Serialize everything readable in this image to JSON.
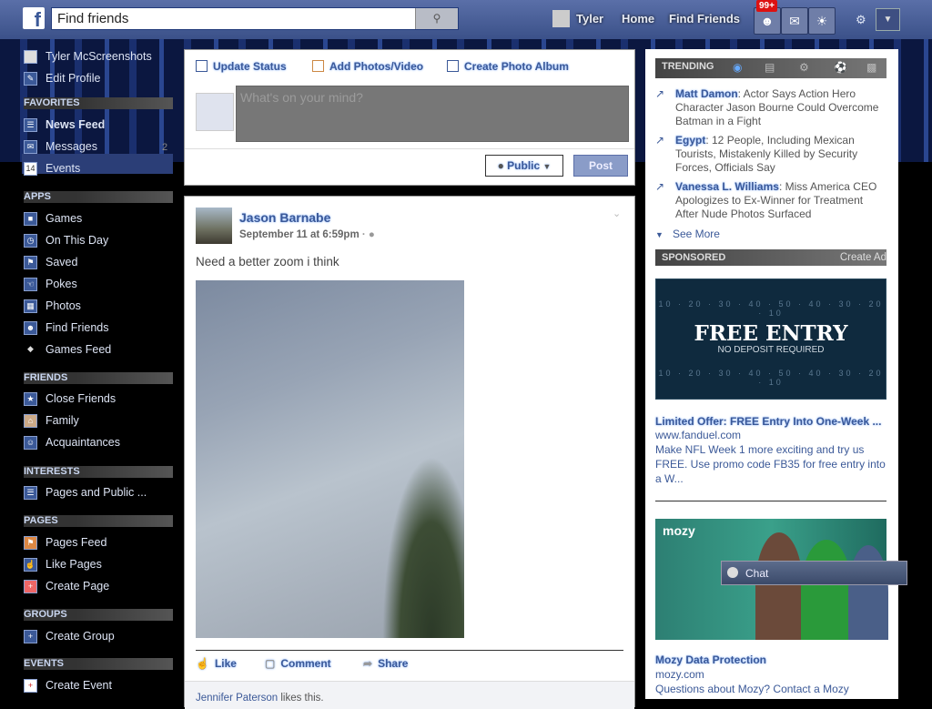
{
  "header": {
    "logo": "f",
    "search_placeholder": "Find friends",
    "user_name": "Tyler",
    "home": "Home",
    "find_friends": "Find Friends",
    "notif_count": "99+"
  },
  "sidebar": {
    "profile_name": "Tyler McScreenshots",
    "edit_profile": "Edit Profile",
    "sections": {
      "favorites": "FAVORITES",
      "apps": "APPS",
      "friends": "FRIENDS",
      "interests": "INTERESTS",
      "pages": "PAGES",
      "groups": "GROUPS",
      "events": "EVENTS"
    },
    "favorites": [
      "News Feed",
      "Messages",
      "Events"
    ],
    "messages_count": "2",
    "events_date": "14",
    "apps": [
      "Games",
      "On This Day",
      "Saved",
      "Pokes",
      "Photos",
      "Find Friends",
      "Games Feed"
    ],
    "friends": [
      "Close Friends",
      "Family",
      "Acquaintances"
    ],
    "interests": [
      "Pages and Public ..."
    ],
    "pages": [
      "Pages Feed",
      "Like Pages",
      "Create Page"
    ],
    "groups": [
      "Create Group"
    ],
    "events": [
      "Create Event"
    ]
  },
  "composer": {
    "tabs": [
      "Update Status",
      "Add Photos/Video",
      "Create Photo Album"
    ],
    "placeholder": "What's on your mind?",
    "privacy": "Public",
    "post": "Post"
  },
  "story": {
    "author": "Jason Barnabe",
    "time": "September 11 at 6:59pm",
    "text": "Need a better zoom i think",
    "actions": [
      "Like",
      "Comment",
      "Share"
    ],
    "liker": "Jennifer Paterson",
    "likes_suffix": " likes this."
  },
  "trending": {
    "title": "TRENDING",
    "items": [
      {
        "name": "Matt Damon",
        "text": ": Actor Says Action Hero Character Jason Bourne Could Overcome Batman in a Fight"
      },
      {
        "name": "Egypt",
        "text": ": 12 People, Including Mexican Tourists, Mistakenly Killed by Security Forces, Officials Say"
      },
      {
        "name": "Vanessa L. Williams",
        "text": ": Miss America CEO Apologizes to Ex-Winner for Treatment After Nude Photos Surfaced"
      }
    ],
    "see_more": "See More"
  },
  "sponsored": {
    "title": "SPONSORED",
    "create_ad": "Create Ad",
    "ad1": {
      "image_big": "FREE ENTRY",
      "image_small": "NO DEPOSIT REQUIRED",
      "yard_top": "10 · 20 · 30 · 40 · 50 · 40 · 30 · 20 · 10",
      "yard_bottom": "10 · 20 · 30 · 40 · 50 · 40 · 30 · 20 · 10",
      "title": "Limited Offer: FREE Entry Into One-Week ...",
      "url": "www.fanduel.com",
      "body": "Make NFL Week 1 more exciting and try us FREE. Use promo code FB35 for free entry into a W..."
    },
    "ad2": {
      "logo": "mozy",
      "title": "Mozy Data Protection",
      "url": "mozy.com",
      "body": "Questions about Mozy? Contact a Mozy"
    }
  },
  "chat": {
    "label": "Chat"
  }
}
